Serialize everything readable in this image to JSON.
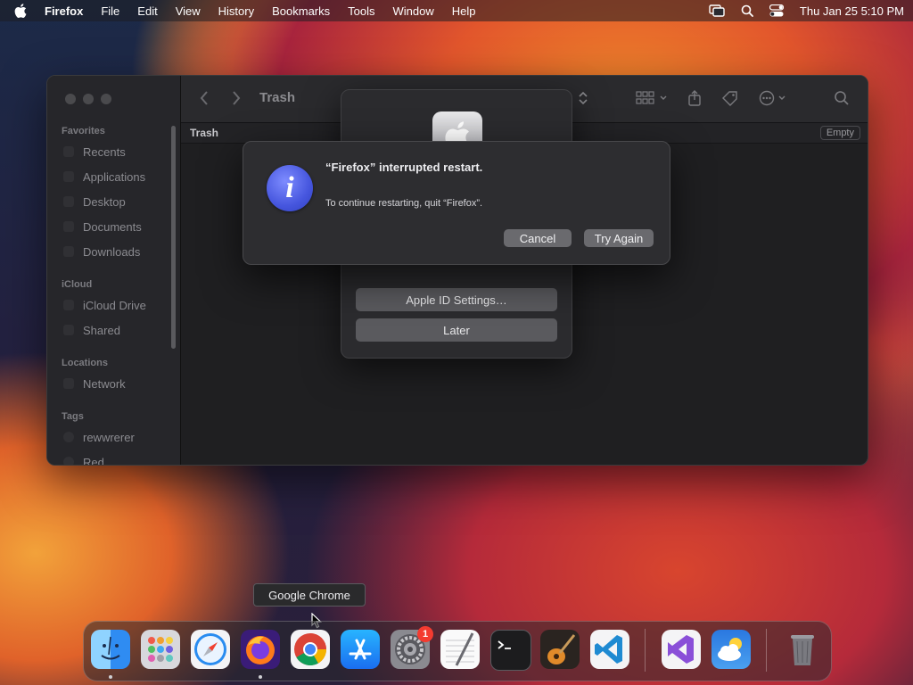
{
  "menubar": {
    "app_name": "Firefox",
    "items": [
      "File",
      "Edit",
      "View",
      "History",
      "Bookmarks",
      "Tools",
      "Window",
      "Help"
    ],
    "clock": "Thu Jan 25  5:10 PM"
  },
  "finder": {
    "title": "Trash",
    "path_label": "Trash",
    "empty_button": "Empty",
    "sidebar": {
      "favorites_header": "Favorites",
      "favorites": [
        "Recents",
        "Applications",
        "Desktop",
        "Documents",
        "Downloads"
      ],
      "icloud_header": "iCloud",
      "icloud": [
        "iCloud Drive",
        "Shared"
      ],
      "locations_header": "Locations",
      "locations": [
        "Network"
      ],
      "tags_header": "Tags",
      "tags": [
        "rewwrerer",
        "Red"
      ]
    }
  },
  "appleid_dialog": {
    "settings_button": "Apple ID Settings…",
    "later_button": "Later"
  },
  "alert": {
    "title": "“Firefox” interrupted restart.",
    "message": "To continue restarting, quit “Firefox”.",
    "cancel_button": "Cancel",
    "try_again_button": "Try Again"
  },
  "tooltip": {
    "text": "Google Chrome"
  },
  "dock": {
    "apps": [
      "Finder",
      "Launchpad",
      "Safari",
      "Firefox",
      "Google Chrome",
      "App Store",
      "System Settings",
      "TextEdit",
      "Terminal",
      "GarageBand",
      "Visual Studio Code",
      "Visual Studio",
      "Weather",
      "Trash"
    ],
    "settings_badge": "1"
  }
}
